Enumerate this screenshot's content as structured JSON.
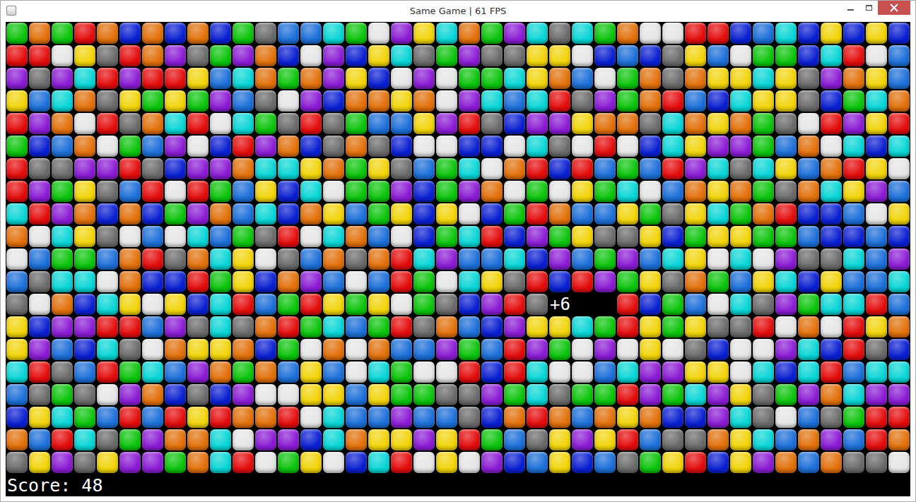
{
  "window": {
    "title": "Same Game | 61 FPS"
  },
  "tile_colors": [
    {
      "code": "r",
      "color": "#e40b0b"
    },
    {
      "code": "g",
      "color": "#0ac40a"
    },
    {
      "code": "b",
      "color": "#1c6fd8"
    },
    {
      "code": "d",
      "color": "#0a1fd2"
    },
    {
      "code": "o",
      "color": "#e2700a"
    },
    {
      "code": "y",
      "color": "#f2d408"
    },
    {
      "code": "p",
      "color": "#8b1bd4"
    },
    {
      "code": "c",
      "color": "#08d6d6"
    },
    {
      "code": "a",
      "color": "#6a6a6a"
    },
    {
      "code": "w",
      "color": "#e6e6e6"
    }
  ],
  "board": {
    "rows": [
      "gogrodododgabbcgwpycogpcacgowwrrdbcdydyd",
      "rrwyaropagpodwpdycagpaayywdbdaybwggdcrwb",
      "papcrprrybcogopydwpwggcyobwgoaoyycyapoyb",
      "ybcoaygygpbawpdooyowpcbcrapgorbdcyyadgco",
      "rpowraocrwcgaragbbypradppyooacoyogawrpyr",
      "gdbowgbpwdrpodaoadwwddwcawrwdcyppgbowcdc",
      "raappradppoccyogyabgcwordrbgbrpcacyboryw",
      "rpgyabrwrgbydcwggpdgpowgwygcwboyogaocypb",
      "crpododgpobcdoybgydywdgrobbygaycgorddbwy",
      "owcyawbwcbgarwcobwdgcrdpgyaaydgyyggbddbd",
      "wbggboraocywaboaorcpbbcdpbgpbcywcwpaacbp",
      "baccwoddrgydopbwbrgwcyardrpgyaogbycdybbc",
      "awodcywydcrbgrygywgadpra...rdgbwcapgccrb",
      "ydpprrbpacaorgcbgraobdpyycgrygyaarwowryo",
      "ypbdcawoyyodgwowobbpgbrpgwpwywadwwpcdrad",
      "crabrgcbpogobybwcgwwrdrcwwbcppyywcdcrbcc",
      "bagawpodadpwwyybyggaapgcaggrpgcpyagpocpp",
      "dycgbrbryroorwcbbpbbadoroboyoddpcawbagrr",
      "obrcagpoocwppdcoyypyrgbaypyrbaaoycbopbro",
      "aypayppgocrwgywdcrwywpdbydbagyrdypoboaaw"
    ]
  },
  "popup": {
    "text": "+6"
  },
  "status_bar": {
    "score": "Score: 48"
  }
}
